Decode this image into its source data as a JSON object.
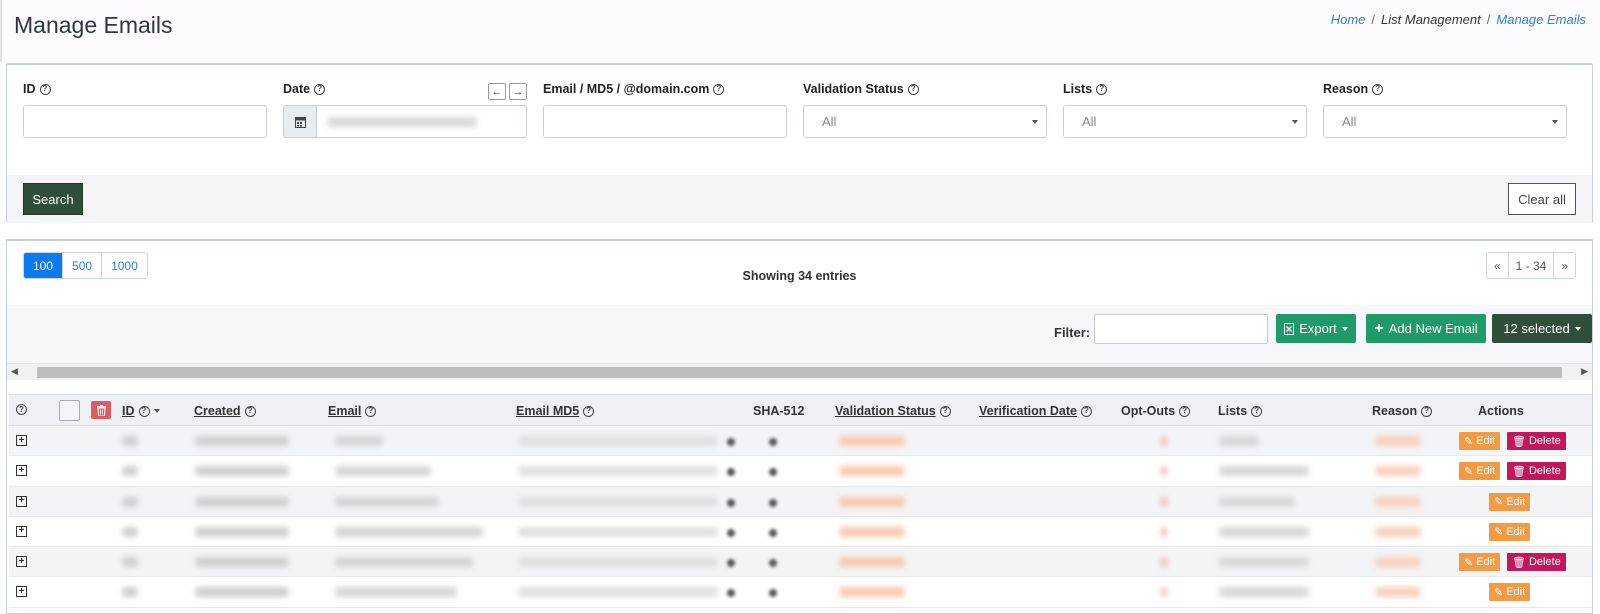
{
  "header": {
    "title": "Manage Emails"
  },
  "breadcrumb": [
    {
      "label": "Home",
      "link": true
    },
    {
      "label": "List Management",
      "link": false
    },
    {
      "label": "Manage Emails",
      "link": true
    }
  ],
  "filters": {
    "id_label": "ID",
    "date_label": "Date",
    "date_prev": "←",
    "date_next": "→",
    "email_label": "Email / MD5 / @domain.com",
    "validation_label": "Validation Status",
    "validation_value": "All",
    "lists_label": "Lists",
    "lists_value": "All",
    "reason_label": "Reason",
    "reason_value": "All",
    "search_button": "Search",
    "clear_button": "Clear all"
  },
  "table_top": {
    "page_sizes": [
      "100",
      "500",
      "1000"
    ],
    "active_page_size": "100",
    "showing": "Showing 34 entries",
    "pager": [
      "«",
      "1 - 34",
      "»"
    ]
  },
  "toolbar": {
    "filter_label": "Filter:",
    "export_label": "Export",
    "add_label": "Add New Email",
    "selected_label": "12 selected"
  },
  "columns": {
    "id": "ID",
    "created": "Created",
    "email": "Email",
    "email_md5": "Email MD5",
    "sha512": "SHA-512",
    "validation_status": "Validation Status",
    "verification_date": "Verification Date",
    "opt_outs": "Opt-Outs",
    "lists": "Lists",
    "reason": "Reason",
    "actions": "Actions"
  },
  "row_actions": {
    "edit": "Edit",
    "delete": "Delete"
  },
  "rows": [
    {
      "has_delete": true
    },
    {
      "has_delete": true
    },
    {
      "has_delete": false
    },
    {
      "has_delete": false
    },
    {
      "has_delete": true
    },
    {
      "has_delete": false
    }
  ],
  "colors": {
    "primary_dark": "#2f4f3a",
    "green": "#1f9a6b",
    "blue": "#0d7bf0",
    "orange": "#f39a44",
    "magenta": "#c2185b"
  }
}
